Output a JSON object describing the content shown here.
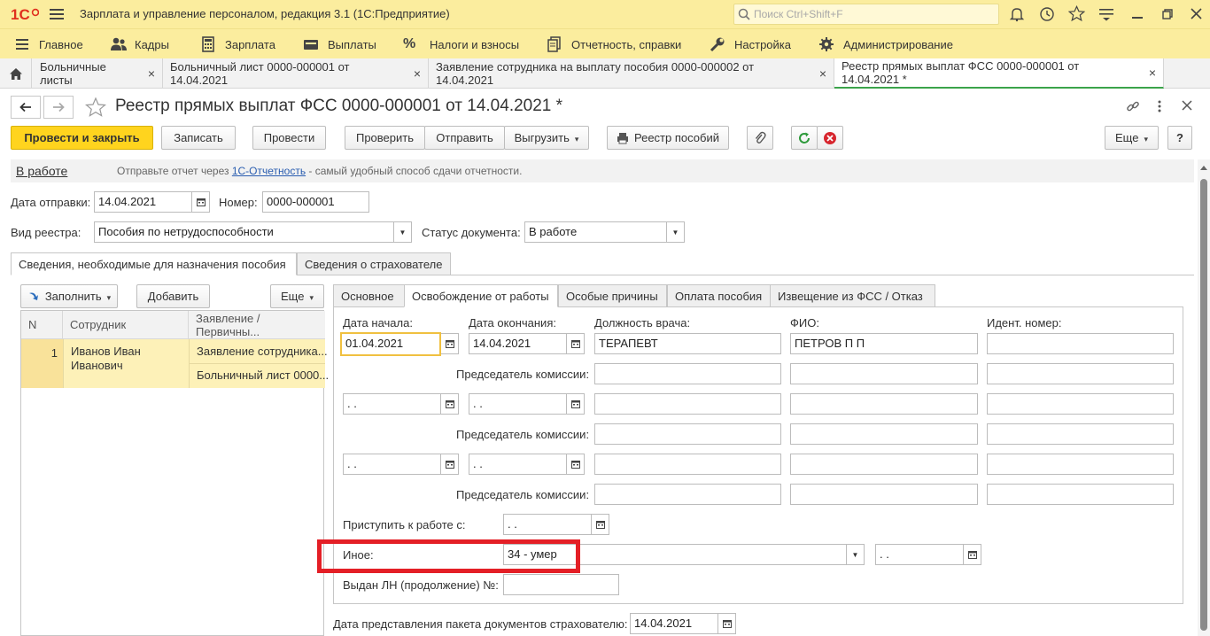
{
  "app": {
    "title": "Зарплата и управление персоналом, редакция 3.1  (1С:Предприятие)",
    "search_placeholder": "Поиск Ctrl+Shift+F"
  },
  "sections": [
    {
      "label": "Главное",
      "icon": "menu-icon"
    },
    {
      "label": "Кадры",
      "icon": "people-icon"
    },
    {
      "label": "Зарплата",
      "icon": "calculator-icon"
    },
    {
      "label": "Выплаты",
      "icon": "wallet-icon"
    },
    {
      "label": "Налоги и взносы",
      "icon": "percent-icon"
    },
    {
      "label": "Отчетность, справки",
      "icon": "reports-icon"
    },
    {
      "label": "Настройка",
      "icon": "wrench-icon"
    },
    {
      "label": "Администрирование",
      "icon": "gear-icon"
    }
  ],
  "open_tabs": [
    {
      "label": "Больничные листы"
    },
    {
      "label": "Больничный лист 0000-000001 от 14.04.2021"
    },
    {
      "label": "Заявление сотрудника на выплату пособия 0000-000002 от 14.04.2021"
    },
    {
      "label": "Реестр прямых выплат ФСС 0000-000001 от 14.04.2021 *"
    }
  ],
  "form": {
    "title": "Реестр прямых выплат ФСС 0000-000001 от 14.04.2021 *",
    "buttons": {
      "post_close": "Провести и закрыть",
      "save": "Записать",
      "post": "Провести",
      "check": "Проверить",
      "send": "Отправить",
      "export": "Выгрузить",
      "registry": "Реестр пособий",
      "more": "Еще",
      "help": "?"
    },
    "info": {
      "state": "В работе",
      "msg_before": "Отправьте отчет через ",
      "msg_link": "1С-Отчетность",
      "msg_after": " - самый удобный способ сдачи отчетности."
    },
    "fields": {
      "send_date_label": "Дата отправки:",
      "send_date": "14.04.2021",
      "number_label": "Номер:",
      "number": "0000-000001",
      "registry_type_label": "Вид реестра:",
      "registry_type": "Пособия по нетрудоспособности",
      "status_label": "Статус документа:",
      "status": "В работе"
    },
    "main_tabs": [
      "Сведения, необходимые для назначения пособия",
      "Сведения о страхователе"
    ],
    "left": {
      "fill": "Заполнить",
      "add": "Добавить",
      "more": "Еще",
      "columns": [
        "N",
        "Сотрудник",
        "Заявление / Первичны..."
      ],
      "rows": [
        {
          "n": "1",
          "employee": "Иванов Иван Иванович",
          "doc1": "Заявление сотрудника...",
          "doc2": "Больничный лист 0000..."
        }
      ]
    },
    "sub_tabs": [
      "Основное",
      "Освобождение от работы",
      "Особые причины",
      "Оплата пособия",
      "Извещение из ФСС / Отказ"
    ],
    "release": {
      "start_label": "Дата начала:",
      "end_label": "Дата окончания:",
      "doctor_pos_label": "Должность врача:",
      "fio_label": "ФИО:",
      "id_label": "Идент.  номер:",
      "row1": {
        "start": "01.04.2021",
        "end": "14.04.2021",
        "doctor_pos": "ТЕРАПЕВТ",
        "fio": "ПЕТРОВ П П",
        "id": ""
      },
      "empty_date": " .  .",
      "chairman_label": "Председатель комиссии:",
      "return_label": "Приступить к работе с:",
      "other_label": "Иное:",
      "other_value": "34 - умер",
      "continuation_label": "Выдан ЛН (продолжение) №:",
      "package_date_label": "Дата представления пакета документов страхователю:",
      "package_date": "14.04.2021"
    }
  }
}
